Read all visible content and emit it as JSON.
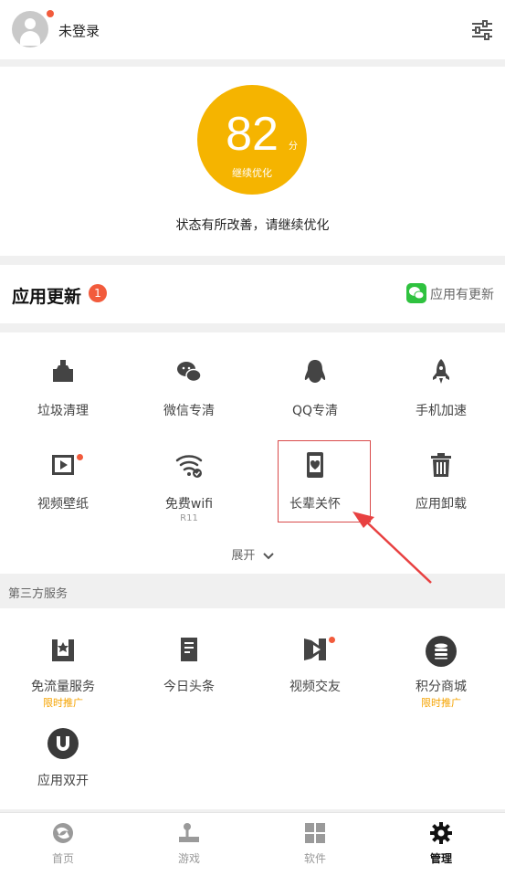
{
  "header": {
    "login_label": "未登录"
  },
  "score": {
    "value": "82",
    "unit": "分",
    "sub": "继续优化",
    "status": "状态有所改善，请继续优化"
  },
  "updates": {
    "title": "应用更新",
    "badge": "1",
    "link": "应用有更新"
  },
  "tools": [
    {
      "label": "垃圾清理",
      "icon": "broom-icon"
    },
    {
      "label": "微信专清",
      "icon": "wechat-icon"
    },
    {
      "label": "QQ专清",
      "icon": "penguin-icon"
    },
    {
      "label": "手机加速",
      "icon": "rocket-icon"
    },
    {
      "label": "视频壁纸",
      "icon": "video-wallpaper-icon"
    },
    {
      "label": "免费wifi",
      "sub": "R11",
      "icon": "wifi-icon"
    },
    {
      "label": "长辈关怀",
      "icon": "phone-heart-icon"
    },
    {
      "label": "应用卸载",
      "icon": "trash-icon"
    }
  ],
  "expand_label": "展开",
  "third_party": {
    "title": "第三方服务",
    "items": [
      {
        "label": "免流量服务",
        "promo": "限时推广",
        "icon": "free-data-icon"
      },
      {
        "label": "今日头条",
        "icon": "news-icon"
      },
      {
        "label": "视频交友",
        "icon": "video-social-icon"
      },
      {
        "label": "积分商城",
        "promo": "限时推广",
        "icon": "coins-icon"
      },
      {
        "label": "应用双开",
        "icon": "dual-app-icon"
      }
    ]
  },
  "tabs": [
    {
      "label": "首页",
      "icon": "home-icon"
    },
    {
      "label": "游戏",
      "icon": "joystick-icon"
    },
    {
      "label": "软件",
      "icon": "apps-grid-icon"
    },
    {
      "label": "管理",
      "icon": "gear-icon",
      "active": true
    }
  ],
  "colors": {
    "accent": "#f5b400",
    "badge": "#f25b3c",
    "wechat": "#2fc23f",
    "highlight": "#d94a4a"
  }
}
